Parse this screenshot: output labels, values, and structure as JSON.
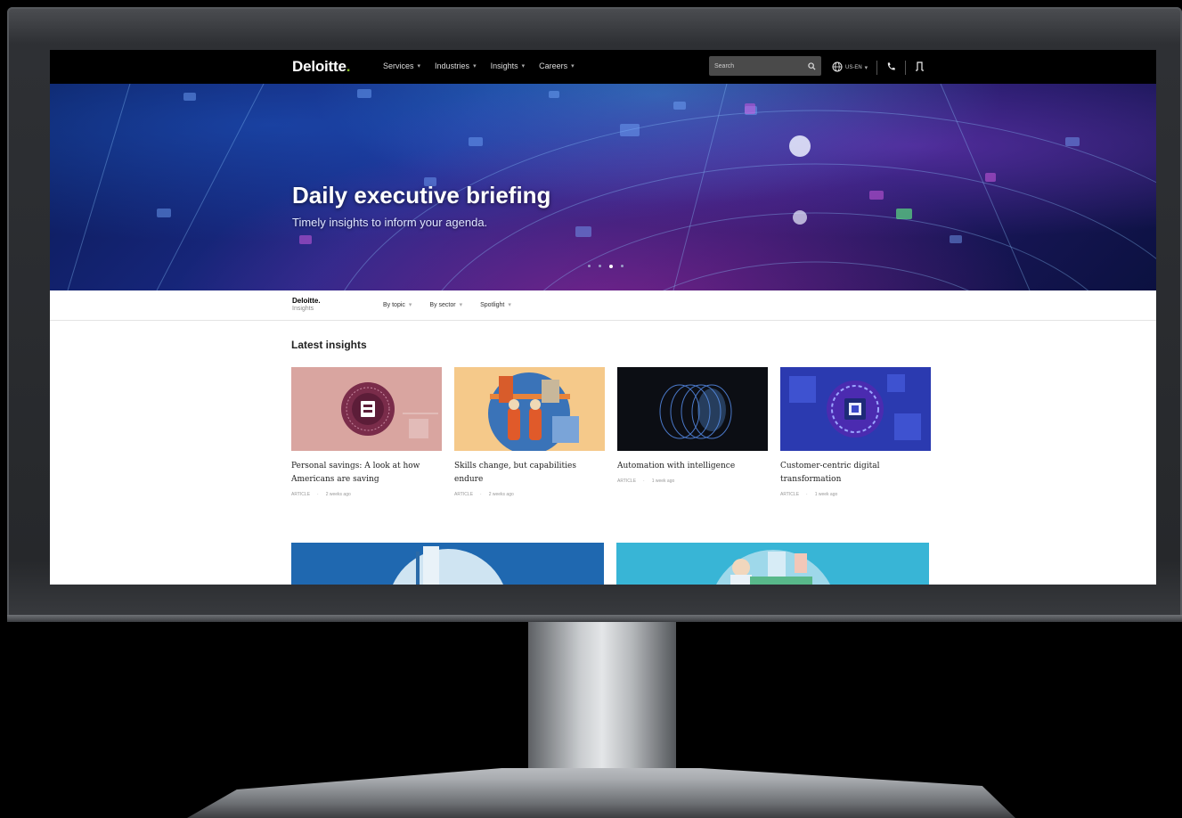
{
  "brand": {
    "name": "Deloitte",
    "dot": ".",
    "accent": "#86bc25"
  },
  "topnav": {
    "items": [
      {
        "label": "Services"
      },
      {
        "label": "Industries"
      },
      {
        "label": "Insights"
      },
      {
        "label": "Careers"
      }
    ],
    "search_placeholder": "Search",
    "locale": "US-EN"
  },
  "hero": {
    "title": "Daily executive briefing",
    "subtitle": "Timely insights to inform your agenda.",
    "slides": 4,
    "active_slide": 3
  },
  "subnav": {
    "logo_main": "Deloitte.",
    "logo_sub": "Insights",
    "items": [
      {
        "label": "By topic"
      },
      {
        "label": "By sector"
      },
      {
        "label": "Spotlight"
      }
    ]
  },
  "latest": {
    "title": "Latest insights",
    "cards": [
      {
        "title": "Personal savings: A look at how Americans are saving",
        "type": "ARTICLE",
        "age": "2 weeks ago"
      },
      {
        "title": "Skills change, but capabilities endure",
        "type": "ARTICLE",
        "age": "2 weeks ago"
      },
      {
        "title": "Automation with intelligence",
        "type": "ARTICLE",
        "age": "1 week ago"
      },
      {
        "title": "Customer-centric digital transformation",
        "type": "ARTICLE",
        "age": "1 week ago"
      }
    ]
  }
}
